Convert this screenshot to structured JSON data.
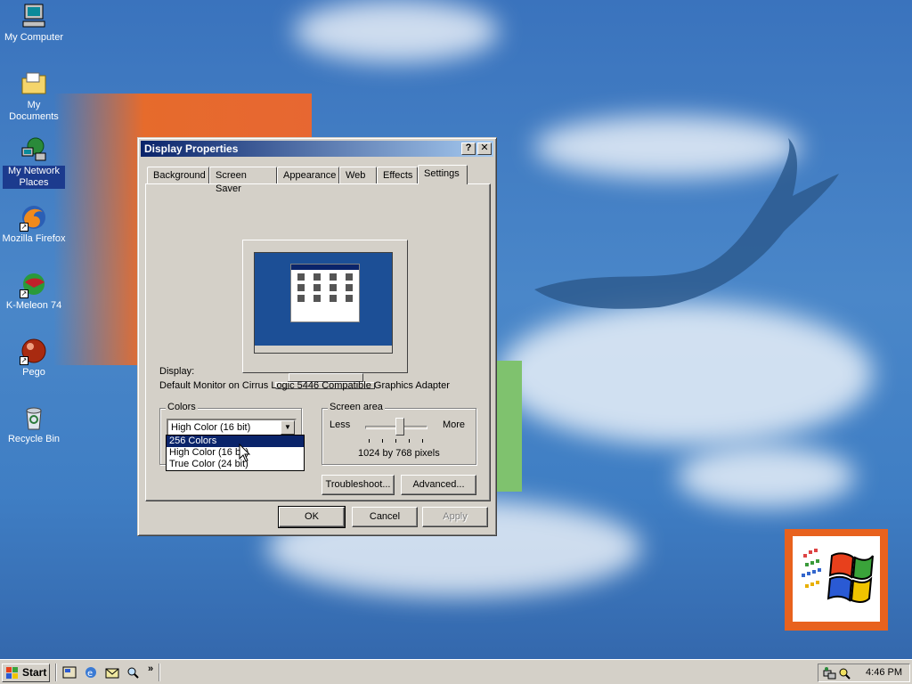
{
  "desktop": {
    "icons": [
      {
        "label": "My Computer",
        "icon": "my-computer-icon"
      },
      {
        "label": "My Documents",
        "icon": "folder-icon"
      },
      {
        "label": "My Network Places",
        "icon": "network-icon"
      },
      {
        "label": "Mozilla Firefox",
        "icon": "firefox-icon"
      },
      {
        "label": "K-Meleon 74",
        "icon": "kmeleon-icon"
      },
      {
        "label": "Pego",
        "icon": "pego-icon"
      },
      {
        "label": "Recycle Bin",
        "icon": "recycle-bin-icon"
      }
    ]
  },
  "window": {
    "title": "Display Properties",
    "help_glyph": "?",
    "close_glyph": "✕",
    "tabs": [
      "Background",
      "Screen Saver",
      "Appearance",
      "Web",
      "Effects",
      "Settings"
    ],
    "active_tab": "Settings",
    "display_label": "Display:",
    "display_value": "Default Monitor on Cirrus Logic 5446 Compatible Graphics Adapter",
    "colors": {
      "legend": "Colors",
      "selected": "High Color (16 bit)",
      "options": [
        "256 Colors",
        "High Color (16 bit)",
        "True Color (24 bit)"
      ],
      "highlighted": "256 Colors"
    },
    "screen_area": {
      "legend": "Screen area",
      "less": "Less",
      "more": "More",
      "value_text": "1024 by 768 pixels",
      "slider_position_fraction": 0.55
    },
    "buttons": {
      "troubleshoot": "Troubleshoot...",
      "advanced": "Advanced...",
      "ok": "OK",
      "cancel": "Cancel",
      "apply": "Apply"
    }
  },
  "taskbar": {
    "start": "Start",
    "clock": "4:46 PM",
    "chevron": "»"
  },
  "colors": {
    "titlebar_start": "#0a246a",
    "titlebar_end": "#a6caf0",
    "face": "#d4d0c8",
    "desktop": "#3a73bd"
  }
}
